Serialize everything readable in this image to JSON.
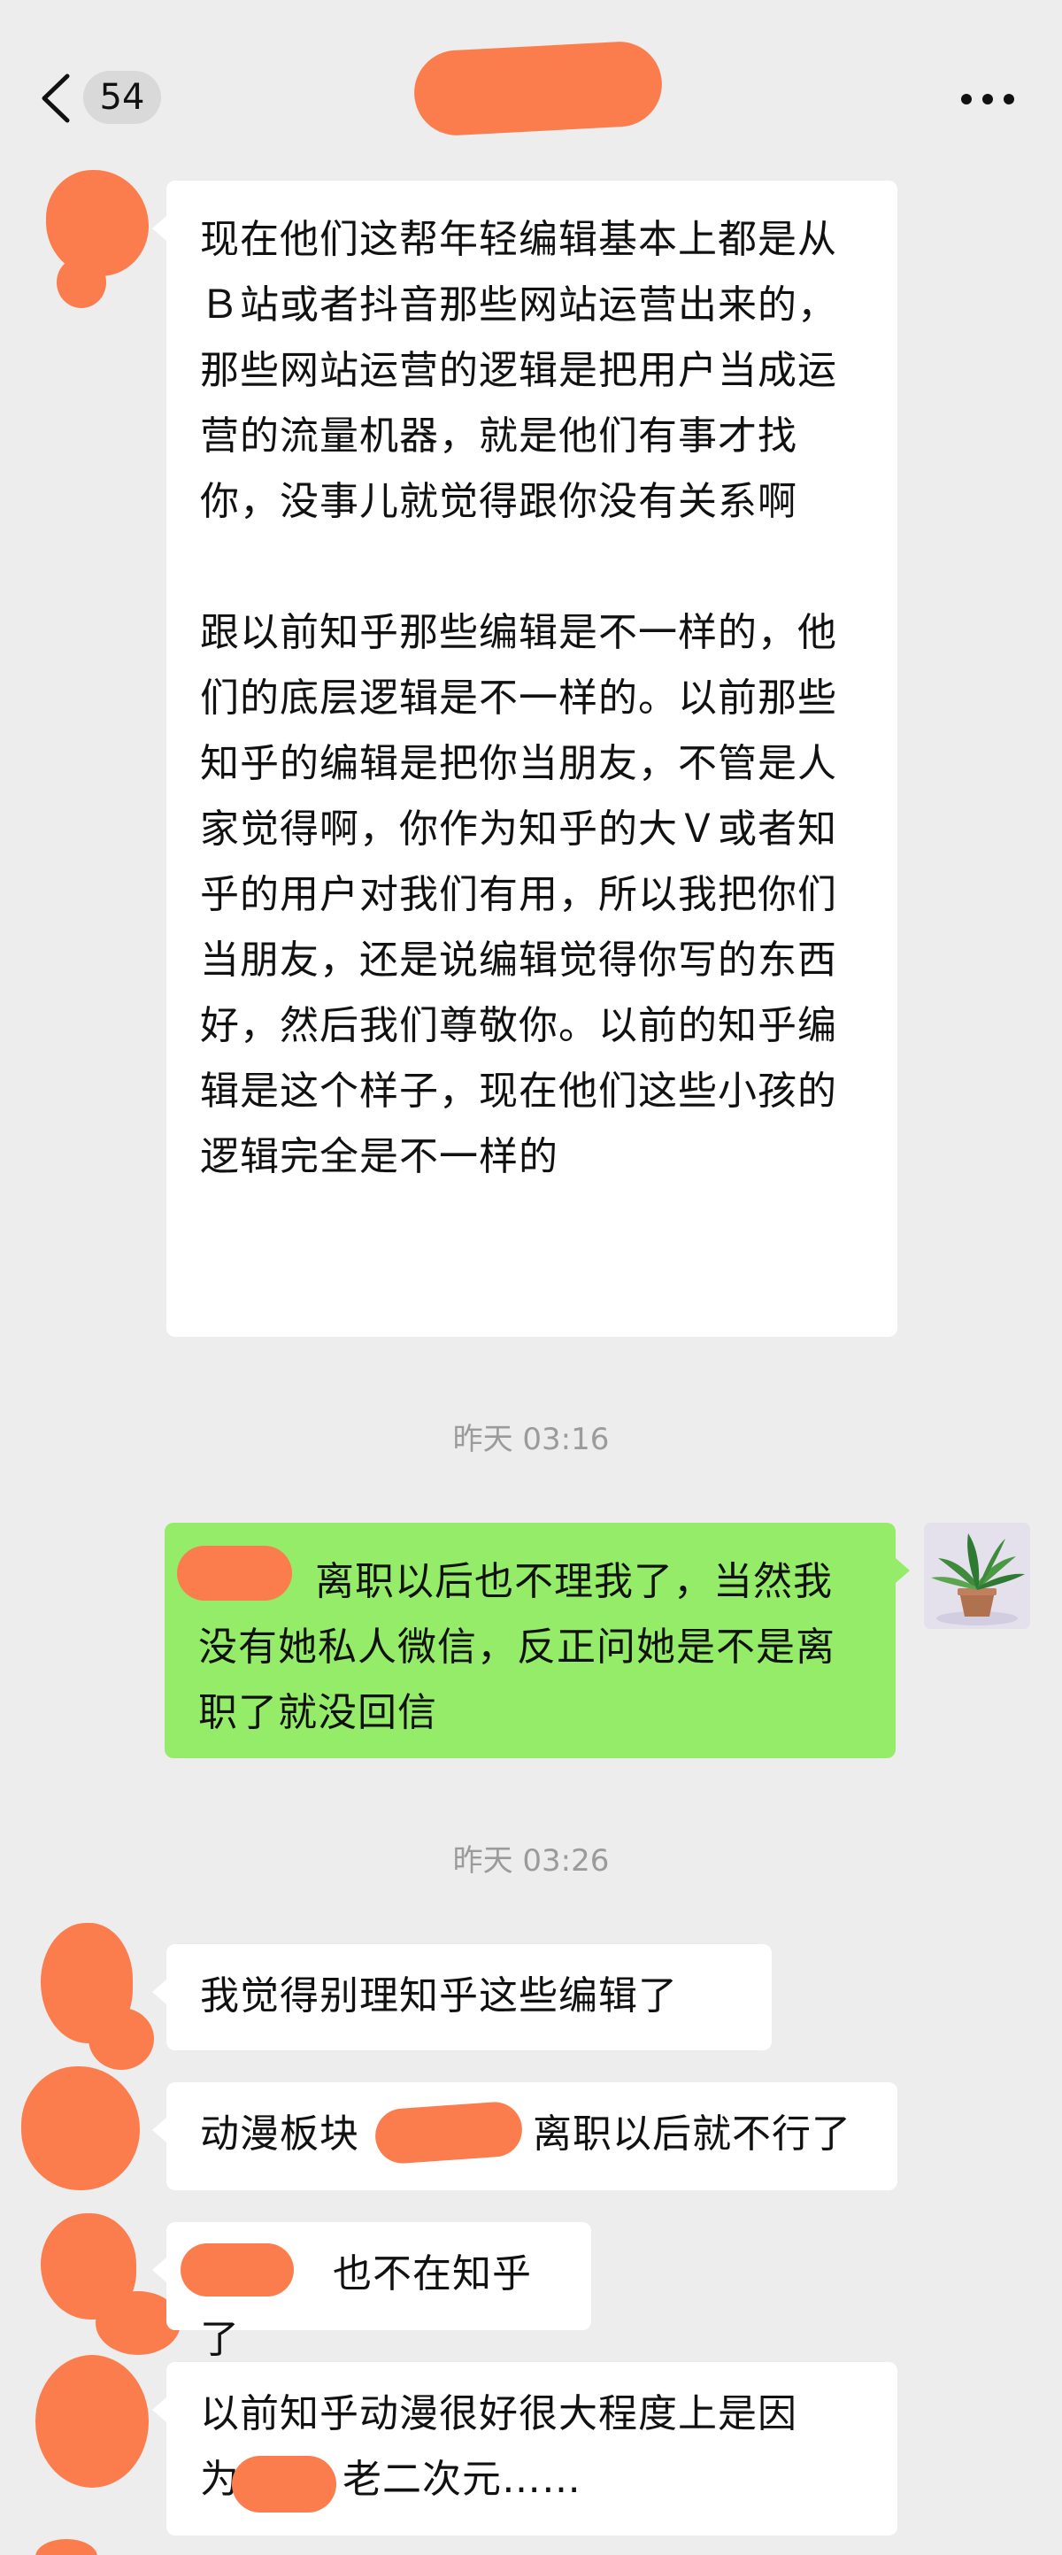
{
  "header": {
    "unread_count": "54"
  },
  "messages": [
    {
      "paragraphs": [
        "现在他们这帮年轻编辑基本上都是从Ｂ站或者抖音那些网站运营出来的，那些网站运营的逻辑是把用户当成运营的流量机器，就是他们有事才找你，没事儿就觉得跟你没有关系啊",
        "跟以前知乎那些编辑是不一样的，他们的底层逻辑是不一样的。以前那些知乎的编辑是把你当朋友，不管是人家觉得啊，你作为知乎的大Ｖ或者知乎的用户对我们有用，所以我把你们当朋友，还是说编辑觉得你写的东西好，然后我们尊敬你。以前的知乎编辑是这个样子，现在他们这些小孩的逻辑完全是不一样的"
      ]
    },
    {
      "text": "离职以后也不理我了，当然我没有她私人微信，反正问她是不是离职了就没回信"
    },
    {
      "text": "我觉得别理知乎这些编辑了"
    },
    {
      "text_a": "动漫板块",
      "text_b": "离职以后就不行了"
    },
    {
      "text": "也不在知乎了"
    },
    {
      "text_a": "以前知乎动漫很好很大程度上是因",
      "text_b": "为",
      "text_c": "老二次元……"
    }
  ],
  "timestamps": [
    "昨天 03:16",
    "昨天 03:26"
  ],
  "colors": {
    "background": "#ededed",
    "incoming_bubble": "#ffffff",
    "outgoing_bubble": "#95ec69",
    "redaction": "#fb7d4d",
    "timestamp": "#9b9b9b"
  },
  "icons": [
    "back-arrow-icon",
    "more-dots-icon",
    "plant-avatar"
  ]
}
